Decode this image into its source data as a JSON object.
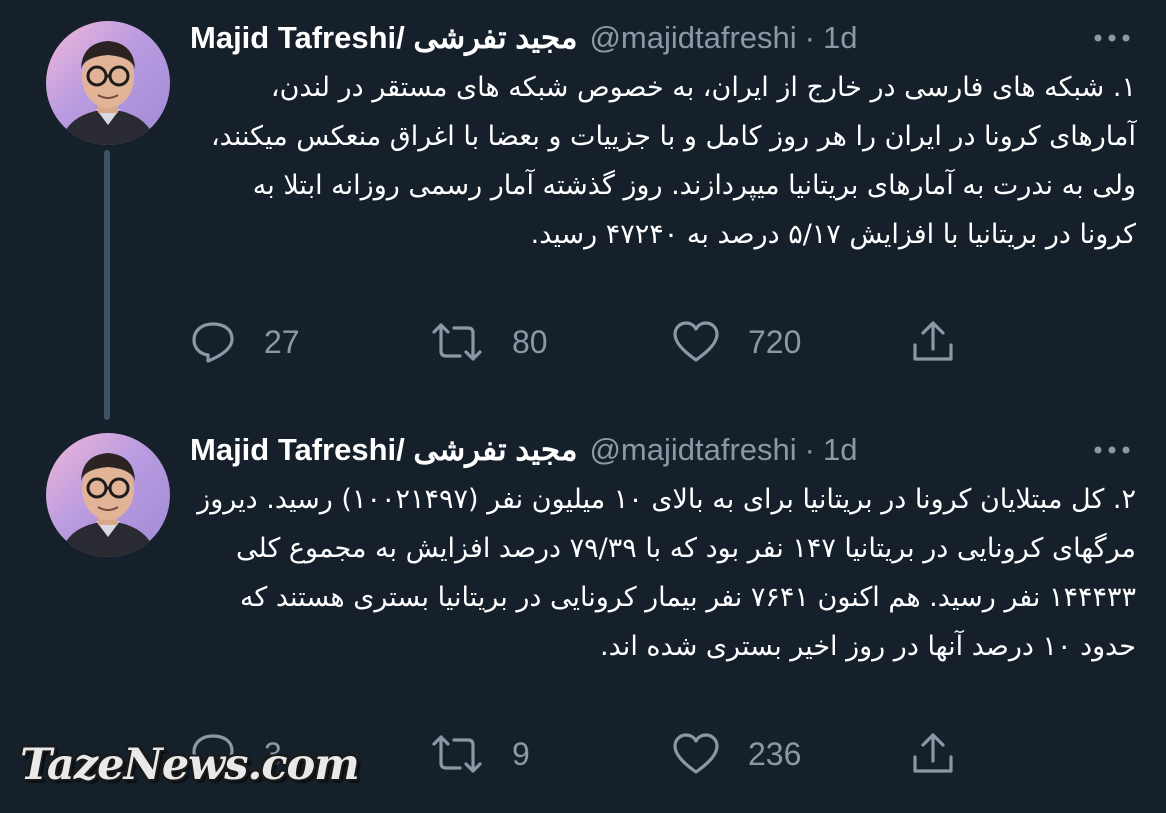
{
  "tweets": [
    {
      "display_name": "Majid Tafreshi/ مجید تفرشی",
      "handle": "@majidtafreshi",
      "separator": "·",
      "time": "1d",
      "text": "۱. شبکه های فارسی در خارج از ایران، به خصوص شبکه های مستقر در لندن، آمارهای کرونا در ایران را هر روز کامل و با جزییات و بعضا با اغراق منعکس میکنند، ولی به ندرت به آمارهای بریتانیا میپردازند. روز گذشته آمار رسمی روزانه ابتلا به کرونا در بریتانیا با افزایش ۵/۱۷ درصد به ۴۷۲۴۰ رسید.",
      "replies": "27",
      "retweets": "80",
      "likes": "720"
    },
    {
      "display_name": "Majid Tafreshi/ مجید تفرشی",
      "handle": "@majidtafreshi",
      "separator": "·",
      "time": "1d",
      "text": "۲. کل مبتلایان کرونا در بریتانیا برای به بالای ۱۰ میلیون نفر (۱۰۰۲۱۴۹۷) رسید. دیروز مرگهای کرونایی در بریتانیا ۱۴۷ نفر بود که با ۷۹/۳۹ درصد افزایش به مجموع کلی ۱۴۴۴۳۳ نفر رسید. هم اکنون ۷۶۴۱ نفر بیمار کرونایی در بریتانیا بستری هستند که حدود ۱۰ درصد آنها در روز اخیر بستری شده اند.",
      "replies": "3",
      "retweets": "9",
      "likes": "236"
    }
  ],
  "icons": {
    "reply": "reply-icon",
    "retweet": "retweet-icon",
    "like": "heart-icon",
    "share": "share-icon",
    "more": "more-options-icon"
  },
  "watermark": "TazeNews.com",
  "colors": {
    "background": "#15202b",
    "secondary_text": "#8b98a5",
    "thread_line": "#3d5466"
  }
}
